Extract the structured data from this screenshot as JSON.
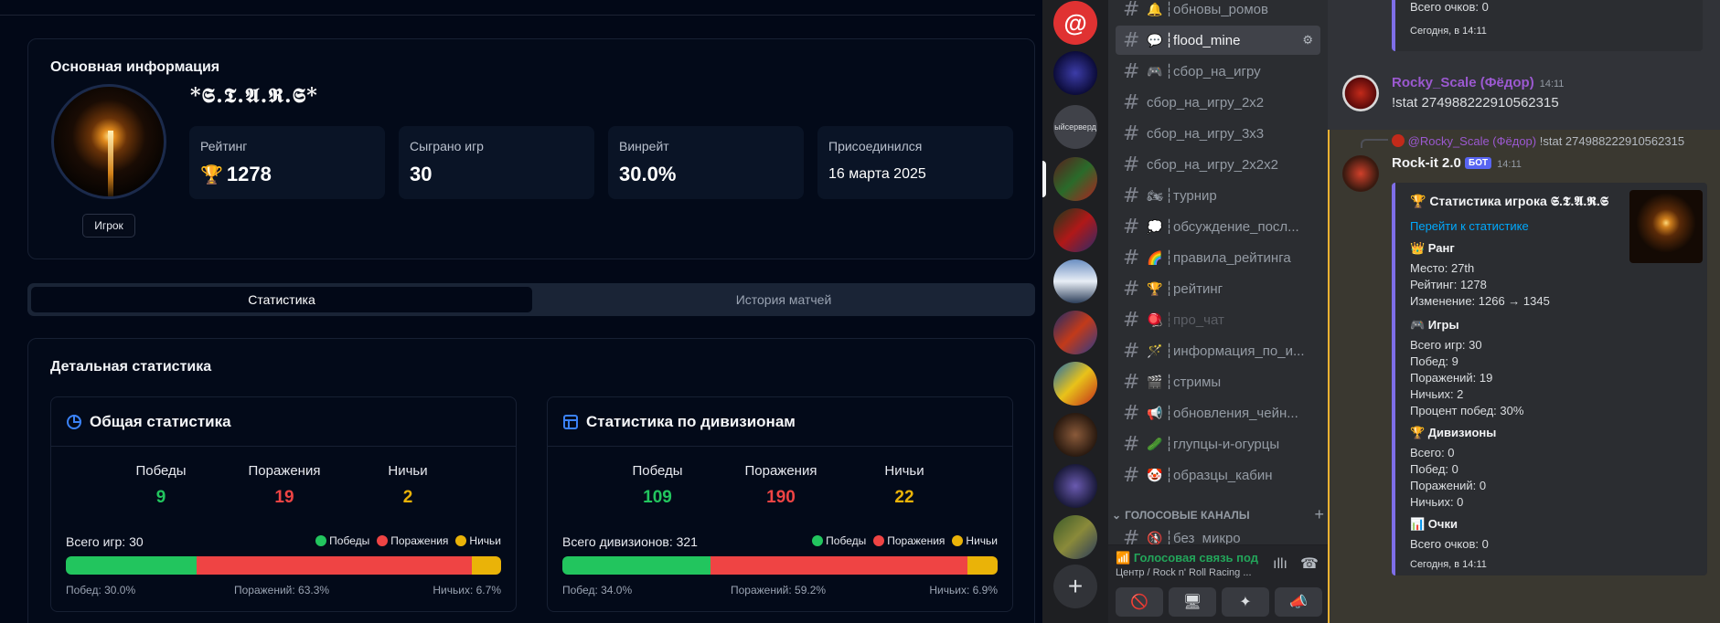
{
  "profile": {
    "section_title": "Основная информация",
    "name": "*𝕾.𝕿.𝕬.𝕽.𝕾*",
    "role": "Игрок",
    "stats": [
      {
        "label": "Рейтинг",
        "value": "1278",
        "icon": "trophy-icon"
      },
      {
        "label": "Сыграно игр",
        "value": "30"
      },
      {
        "label": "Винрейт",
        "value": "30.0%"
      },
      {
        "label": "Присоединился",
        "value": "16 марта 2025"
      }
    ]
  },
  "tabs": {
    "stats": "Статистика",
    "history": "История матчей"
  },
  "detail": {
    "title": "Детальная статистика",
    "general": {
      "title": "Общая статистика",
      "kpis": [
        {
          "label": "Победы",
          "value": "9"
        },
        {
          "label": "Поражения",
          "value": "19"
        },
        {
          "label": "Ничьи",
          "value": "2"
        }
      ],
      "total": "Всего игр: 30",
      "legend": [
        "Победы",
        "Поражения",
        "Ничьи"
      ],
      "bar": {
        "wins": 30.0,
        "losses": 63.3,
        "draws": 6.7
      },
      "pcts": {
        "wins": "Побед: 30.0%",
        "losses": "Поражений: 63.3%",
        "draws": "Ничьих: 6.7%"
      }
    },
    "divisions": {
      "title": "Статистика по дивизионам",
      "kpis": [
        {
          "label": "Победы",
          "value": "109"
        },
        {
          "label": "Поражения",
          "value": "190"
        },
        {
          "label": "Ничьи",
          "value": "22"
        }
      ],
      "total": "Всего дивизионов: 321",
      "legend": [
        "Победы",
        "Поражения",
        "Ничьи"
      ],
      "bar": {
        "wins": 34.0,
        "losses": 59.2,
        "draws": 6.9
      },
      "pcts": {
        "wins": "Побед: 34.0%",
        "losses": "Поражений: 59.2%",
        "draws": "Ничьих: 6.9%"
      }
    }
  },
  "colors": {
    "win": "#22c55e",
    "loss": "#ef4444",
    "draw": "#eab308",
    "embed_accent": "#7e6ee8",
    "link": "#00a8fc",
    "bot_badge": "#5865f2"
  },
  "servers": {
    "server_3_label": "ыйсерверд"
  },
  "channels": [
    {
      "emoji": "🔔",
      "name": "┆обновы_ромов"
    },
    {
      "emoji": "💬",
      "name": "┆flood_mine",
      "selected": true
    },
    {
      "emoji": "🎮",
      "name": "┆сбор_на_игру"
    },
    {
      "emoji": "",
      "name": "сбор_на_игру_2x2"
    },
    {
      "emoji": "",
      "name": "сбор_на_игру_3x3"
    },
    {
      "emoji": "",
      "name": "сбор_на_игру_2x2x2"
    },
    {
      "emoji": "🏍",
      "name": "┆турнир"
    },
    {
      "emoji": "💭",
      "name": "┆обсуждение_посл..."
    },
    {
      "emoji": "🌈",
      "name": "┆правила_рейтинга"
    },
    {
      "emoji": "🏆",
      "name": "┆рейтинг"
    },
    {
      "emoji": "🪀",
      "name": "┆про_чат",
      "muted": true
    },
    {
      "emoji": "🪄",
      "name": "┆информация_по_и..."
    },
    {
      "emoji": "🎬",
      "name": "┆стримы"
    },
    {
      "emoji": "📢",
      "name": "┆обновления_чейн..."
    },
    {
      "emoji": "🥒",
      "name": "┆глупцы-и-огурцы"
    },
    {
      "emoji": "🤡",
      "name": "┆образцы_кабин"
    }
  ],
  "voice_category": "ГОЛОСОВЫЕ КАНАЛЫ",
  "voice_channel": {
    "emoji": "🚯",
    "name": "┆без_микро"
  },
  "voice_status": {
    "title": "Голосовая связь под",
    "subtitle": "Центр / Rock n' Roll Racing ..."
  },
  "chat": {
    "prev_embed": {
      "line": "Всего очков: 0",
      "footer": "Сегодня, в 14:11"
    },
    "msg1": {
      "user": "Rocky_Scale (Фёдор)",
      "time": "14:11",
      "text": "!stat 274988222910562315"
    },
    "reply": {
      "user": "@Rocky_Scale (Фёдор)",
      "text": "!stat 274988222910562315"
    },
    "msg2": {
      "user": "Rock-it 2.0",
      "badge": "БОТ",
      "time": "14:11"
    },
    "embed": {
      "title": "🏆 Статистика игрока 𝕾.𝕿.𝕬.𝕽.𝕾",
      "link": "Перейти к статистике",
      "rank_h": "👑 Ранг",
      "rank": [
        "Место: 27th",
        "Рейтинг: 1278",
        "Изменение: 1266 → 1345"
      ],
      "games_h": "🎮 Игры",
      "games": [
        "Всего игр: 30",
        "Побед: 9",
        "Поражений: 19",
        "Ничьих: 2",
        "Процент побед: 30%"
      ],
      "div_h": "🏆 Дивизионы",
      "div": [
        "Всего: 0",
        "Побед: 0",
        "Поражений: 0",
        "Ничьих: 0"
      ],
      "pts_h": "📊 Очки",
      "pts": [
        "Всего очков: 0"
      ],
      "footer": "Сегодня, в 14:11"
    }
  }
}
